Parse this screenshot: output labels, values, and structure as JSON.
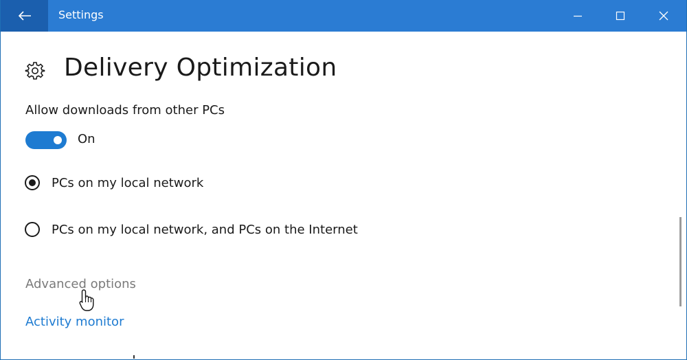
{
  "window": {
    "title": "Settings",
    "accent_color": "#2b7cd3",
    "back_button_color": "#1b5fae",
    "controls": [
      "minimize-icon",
      "maximize-icon",
      "close-icon"
    ]
  },
  "page": {
    "icon": "gear-icon",
    "title": "Delivery Optimization"
  },
  "downloads": {
    "label": "Allow downloads from other PCs",
    "toggle_state": "On",
    "toggle_on": true
  },
  "radio_options": [
    {
      "label": "PCs on my local network",
      "selected": true
    },
    {
      "label": "PCs on my local network, and PCs on the Internet",
      "selected": false
    }
  ],
  "links": {
    "advanced": "Advanced options",
    "activity": "Activity monitor",
    "link_color": "#1e7bd1"
  }
}
